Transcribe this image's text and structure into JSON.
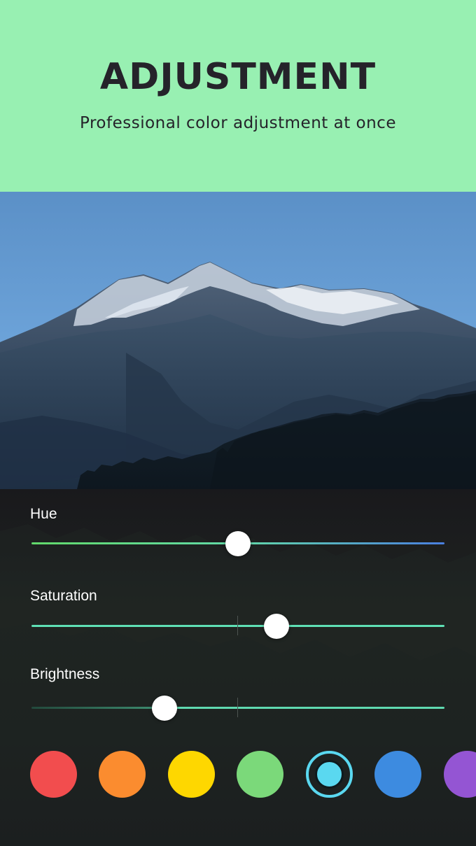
{
  "banner": {
    "title": "ADJUSTMENT",
    "subtitle": "Professional color adjustment at once",
    "background": "#98f0b2"
  },
  "photo": {
    "subject": "mountain-landscape"
  },
  "sliders": [
    {
      "label": "Hue",
      "value_fraction": 0.5,
      "style": "hue-gradient"
    },
    {
      "label": "Saturation",
      "value_fraction": 0.595,
      "style": "centered"
    },
    {
      "label": "Brightness",
      "value_fraction": 0.32,
      "style": "centered"
    }
  ],
  "swatches": [
    {
      "name": "red",
      "color": "#f24d4e",
      "selected": false
    },
    {
      "name": "orange",
      "color": "#fb8c2f",
      "selected": false
    },
    {
      "name": "yellow",
      "color": "#fed700",
      "selected": false
    },
    {
      "name": "green",
      "color": "#7bd97a",
      "selected": false
    },
    {
      "name": "cyan",
      "color": "#5ad8f0",
      "selected": true
    },
    {
      "name": "blue",
      "color": "#3d8be0",
      "selected": false
    },
    {
      "name": "purple",
      "color": "#9455d3",
      "selected": false
    }
  ]
}
